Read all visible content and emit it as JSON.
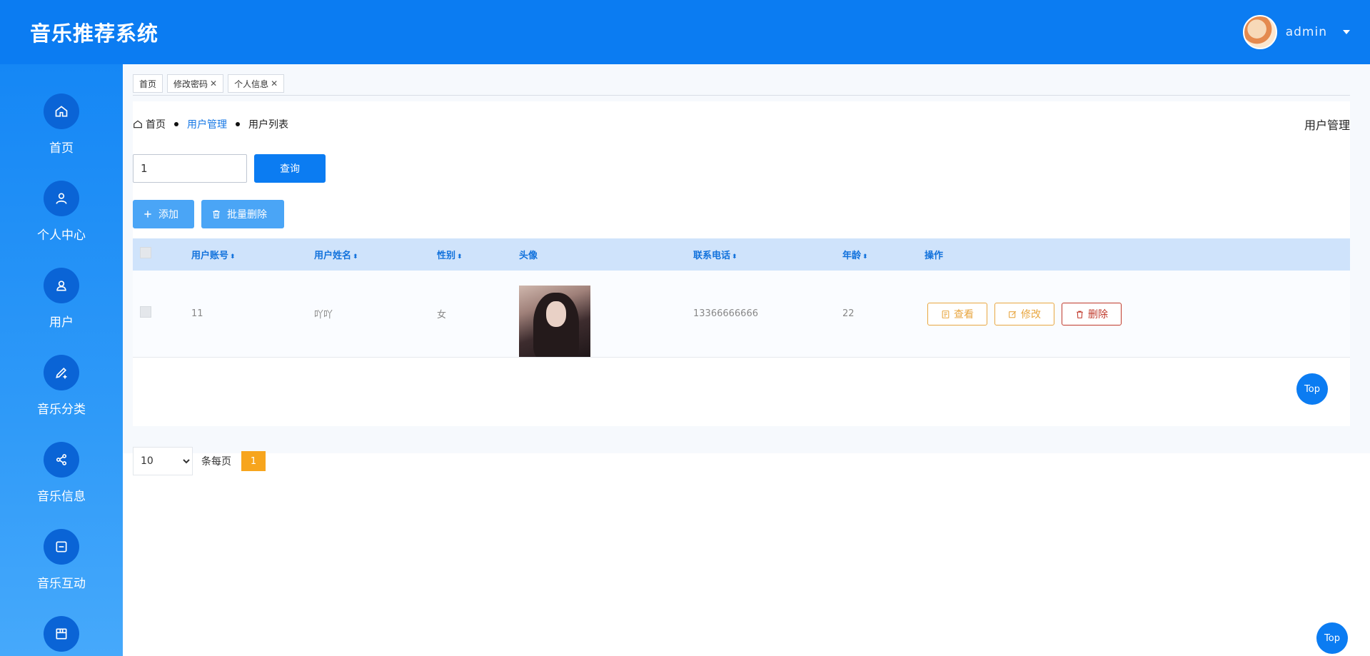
{
  "header": {
    "app_title": "音乐推荐系统",
    "user_name": "admin"
  },
  "sidebar": {
    "items": [
      {
        "label": "首页",
        "icon": "home-icon"
      },
      {
        "label": "个人中心",
        "icon": "user-icon"
      },
      {
        "label": "用户",
        "icon": "user-outline-icon"
      },
      {
        "label": "音乐分类",
        "icon": "edit-icon"
      },
      {
        "label": "音乐信息",
        "icon": "share-icon"
      },
      {
        "label": "音乐互动",
        "icon": "minus-box-icon"
      },
      {
        "label": "",
        "icon": "box-icon"
      }
    ]
  },
  "tabs": [
    {
      "label": "首页",
      "closable": false
    },
    {
      "label": "修改密码",
      "closable": true
    },
    {
      "label": "个人信息",
      "closable": true
    }
  ],
  "breadcrumb": {
    "home": "首页",
    "level1": "用户管理",
    "level2": "用户列表"
  },
  "section_title": "用户管理",
  "search": {
    "value": "1",
    "button_label": "查询"
  },
  "actions": {
    "add_label": "添加",
    "batch_delete_label": "批量删除"
  },
  "table": {
    "columns": [
      "用户账号",
      "用户姓名",
      "性别",
      "头像",
      "联系电话",
      "年龄",
      "操作"
    ],
    "rows": [
      {
        "account": "11",
        "name": "吖吖",
        "gender": "女",
        "phone": "13366666666",
        "age": "22"
      }
    ],
    "row_actions": {
      "view": "查看",
      "edit": "修改",
      "delete": "删除"
    }
  },
  "pagination": {
    "page_size": "10",
    "per_page_label": "条每页",
    "current_page": "1"
  },
  "top_button_label": "Top",
  "colors": {
    "primary": "#0b7cf2",
    "sidebar_icon_bg": "#0a64d6",
    "table_header_bg": "#cfe3fb",
    "warning": "#e8a640",
    "danger": "#c0392b",
    "page_active": "#f7a51d"
  }
}
